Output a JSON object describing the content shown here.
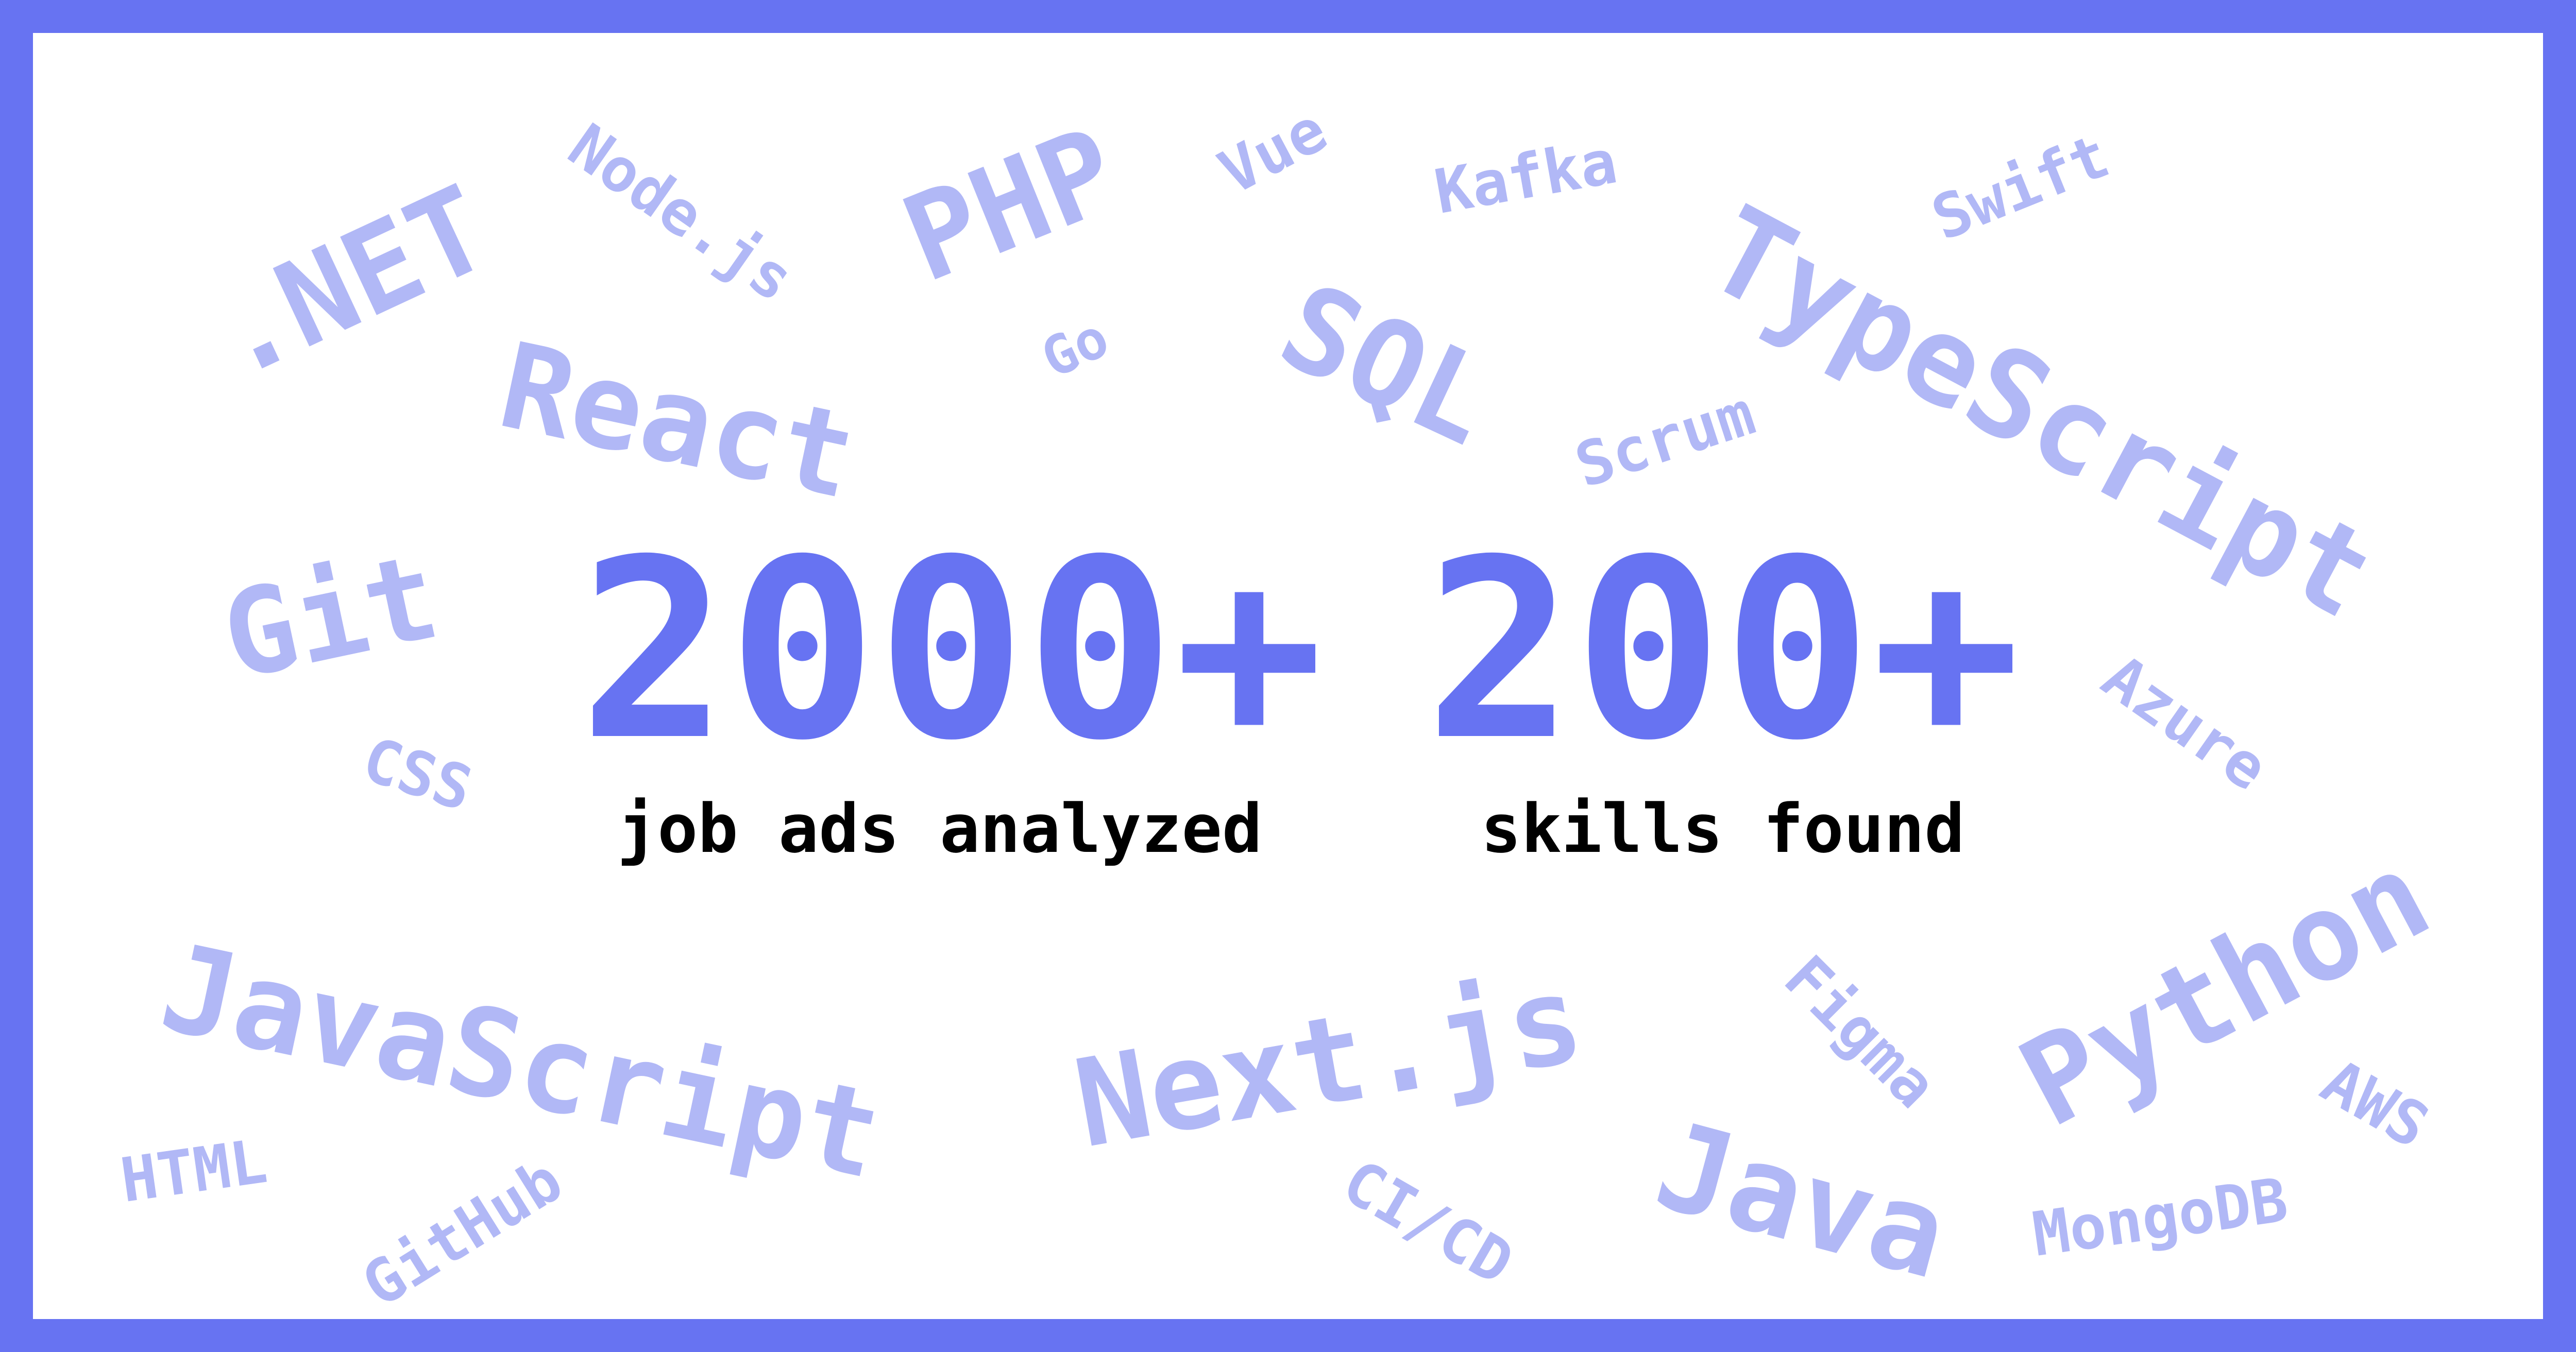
{
  "colors": {
    "frame": "#6773f2",
    "background": "#ffffff",
    "stat_number": "#6773f2",
    "stat_label": "#000000",
    "skill_word": "#b1b8f6"
  },
  "stats": [
    {
      "value": "2000+",
      "label": "job ads analyzed"
    },
    {
      "value": "200+",
      "label": "skills found"
    }
  ],
  "skills": {
    "net": ".NET",
    "nodejs": "Node.js",
    "php": "PHP",
    "vue": "Vue",
    "kafka": "Kafka",
    "swift": "Swift",
    "typescript": "TypeScript",
    "react": "React",
    "go": "Go",
    "sql": "SQL",
    "scrum": "Scrum",
    "git": "Git",
    "css": "CSS",
    "azure": "Azure",
    "javascript": "JavaScript",
    "nextjs": "Next.js",
    "figma": "Figma",
    "python": "Python",
    "html": "HTML",
    "github": "GitHub",
    "cicd": "CI/CD",
    "java": "Java",
    "aws": "AWS",
    "mongodb": "MongoDB"
  }
}
